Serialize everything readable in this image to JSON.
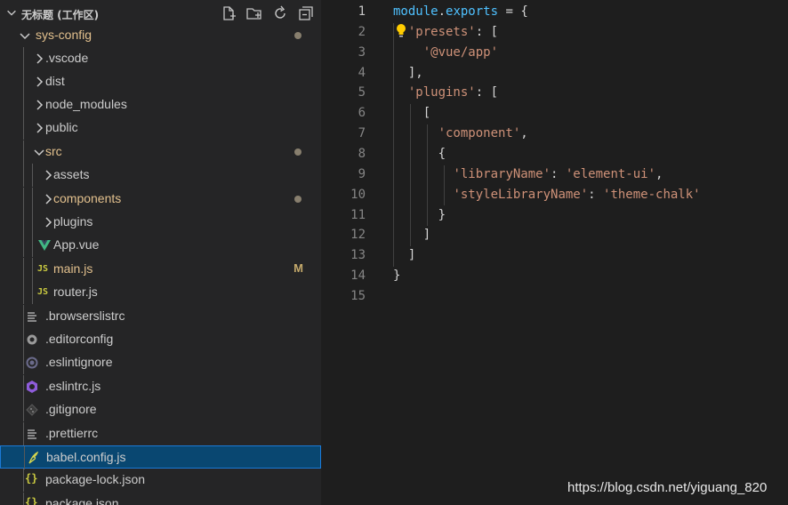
{
  "explorer": {
    "title": "无标题 (工作区)",
    "buttons": [
      "new-file-icon",
      "new-folder-icon",
      "refresh-icon",
      "collapse-all-icon"
    ]
  },
  "tree": [
    {
      "label": "sys-config",
      "type": "folder-open",
      "modified": true,
      "dot": true
    },
    {
      "label": ".vscode",
      "type": "folder"
    },
    {
      "label": "dist",
      "type": "folder"
    },
    {
      "label": "node_modules",
      "type": "folder"
    },
    {
      "label": "public",
      "type": "folder"
    },
    {
      "label": "src",
      "type": "folder-open",
      "modified": true,
      "dot": true
    },
    {
      "label": "assets",
      "type": "folder"
    },
    {
      "label": "components",
      "type": "folder",
      "modified": true,
      "dot": true
    },
    {
      "label": "plugins",
      "type": "folder"
    },
    {
      "label": "App.vue",
      "type": "vue"
    },
    {
      "label": "main.js",
      "type": "js",
      "modified": true,
      "badge": "M"
    },
    {
      "label": "router.js",
      "type": "js"
    },
    {
      "label": ".browserslistrc",
      "type": "lines"
    },
    {
      "label": ".editorconfig",
      "type": "gear"
    },
    {
      "label": ".eslintignore",
      "type": "circle"
    },
    {
      "label": ".eslintrc.js",
      "type": "eslint"
    },
    {
      "label": ".gitignore",
      "type": "git"
    },
    {
      "label": ".prettierrc",
      "type": "lines"
    },
    {
      "label": "babel.config.js",
      "type": "babel",
      "selected": true
    },
    {
      "label": "package-lock.json",
      "type": "json"
    },
    {
      "label": "package.json",
      "type": "json"
    }
  ],
  "icons": {
    "js": "JS",
    "json": "{}"
  },
  "editor": {
    "line_numbers": [
      "1",
      "2",
      "3",
      "4",
      "5",
      "6",
      "7",
      "8",
      "9",
      "10",
      "11",
      "12",
      "13",
      "14",
      "15"
    ],
    "current_line": "1"
  },
  "code_lines": [
    [
      [
        "var",
        "module"
      ],
      [
        "plain",
        "."
      ],
      [
        "var",
        "exports"
      ],
      [
        "plain",
        " = {"
      ]
    ],
    [
      [
        "plain",
        "  "
      ],
      [
        "str",
        "'presets'"
      ],
      [
        "plain",
        ": ["
      ]
    ],
    [
      [
        "plain",
        "    "
      ],
      [
        "str",
        "'@vue/app'"
      ]
    ],
    [
      [
        "plain",
        "  ],"
      ]
    ],
    [
      [
        "plain",
        "  "
      ],
      [
        "str",
        "'plugins'"
      ],
      [
        "plain",
        ": ["
      ]
    ],
    [
      [
        "plain",
        "    ["
      ]
    ],
    [
      [
        "plain",
        "      "
      ],
      [
        "str",
        "'component'"
      ],
      [
        "plain",
        ","
      ]
    ],
    [
      [
        "plain",
        "      {"
      ]
    ],
    [
      [
        "plain",
        "        "
      ],
      [
        "str",
        "'libraryName'"
      ],
      [
        "plain",
        ": "
      ],
      [
        "str",
        "'element-ui'"
      ],
      [
        "plain",
        ","
      ]
    ],
    [
      [
        "plain",
        "        "
      ],
      [
        "str",
        "'styleLibraryName'"
      ],
      [
        "plain",
        ": "
      ],
      [
        "str",
        "'theme-chalk'"
      ]
    ],
    [
      [
        "plain",
        "      }"
      ]
    ],
    [
      [
        "plain",
        "    ]"
      ]
    ],
    [
      [
        "plain",
        "  ]"
      ]
    ],
    [
      [
        "plain",
        "}"
      ]
    ],
    []
  ],
  "watermark": "https://blog.csdn.net/yiguang_820",
  "colors": {
    "sidebar_bg": "#252526",
    "editor_bg": "#1e1e1e",
    "selection": "#094771",
    "modified": "#e2c08d",
    "string": "#ce9178",
    "variable": "#4fc1ff"
  }
}
